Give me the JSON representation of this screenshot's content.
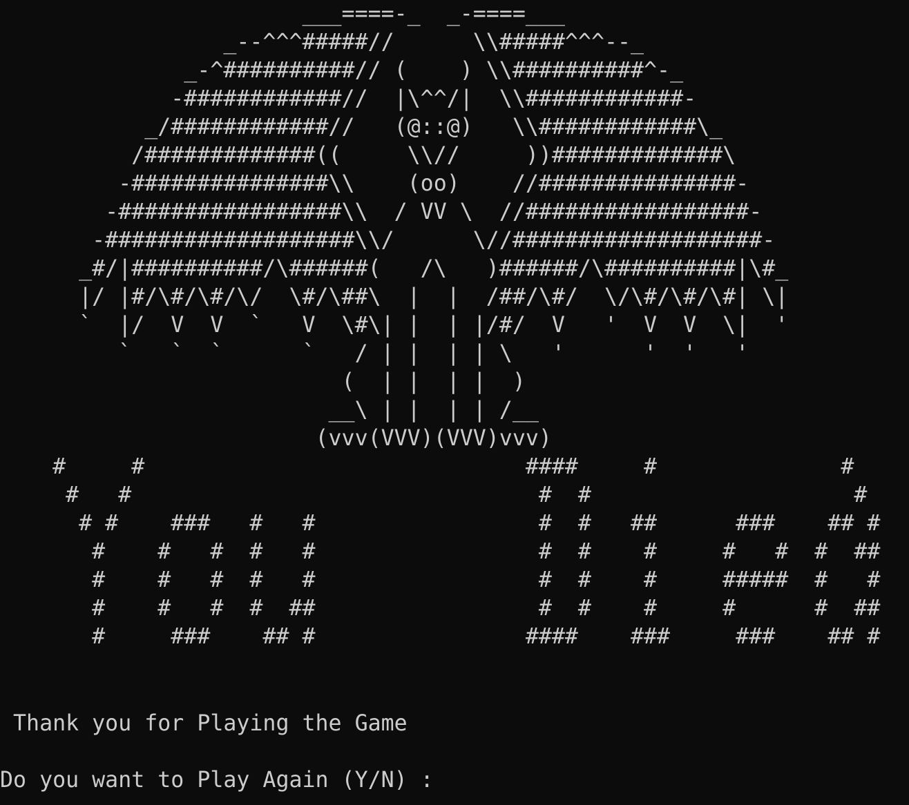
{
  "terminal": {
    "art_lines": [
      "                       ___====-_  _-====___",
      "                 _--^^^#####//      \\\\#####^^^--_",
      "              _-^##########// (    ) \\\\##########^-_",
      "             -############//  |\\^^/|  \\\\############-",
      "           _/############//   (@::@)   \\\\############\\_",
      "          /#############((     \\\\//     ))#############\\",
      "         -###############\\\\    (oo)    //###############-",
      "        -#################\\\\  / VV \\  //#################-",
      "       -###################\\\\/      \\//###################-",
      "      _#/|##########/\\######(   /\\   )######/\\##########|\\#_",
      "      |/ |#/\\#/\\#/\\/  \\#/\\##\\  |  |  /##/\\#/  \\/\\#/\\#/\\#| \\|",
      "      `  |/  V  V  `   V  \\#\\| |  | |/#/  V   '  V  V  \\|  '",
      "         `   `  `      `   / | |  | | \\   '      '  '   '",
      "                          (  | |  | |  )",
      "                         __\\ | |  | | /__",
      "                        (vvv(VVV)(VVV)vvv)",
      "    #     #                             ####     #              #",
      "     #   #                               #  #                    #",
      "      # #    ###   #   #                 #  #   ##      ###    ## #",
      "       #    #   #  #   #                 #  #    #     #   #  #  ##",
      "       #    #   #  #   #                 #  #    #     #####  #   #",
      "       #    #   #  #  ##                 #  #    #     #      #  ##",
      "       #     ###    ## #                ####    ###     ###    ## #"
    ],
    "thanks_message": " Thank you for Playing the Game",
    "prompt_text": "Do you want to Play Again (Y/N) : ",
    "prompt_value": ""
  }
}
